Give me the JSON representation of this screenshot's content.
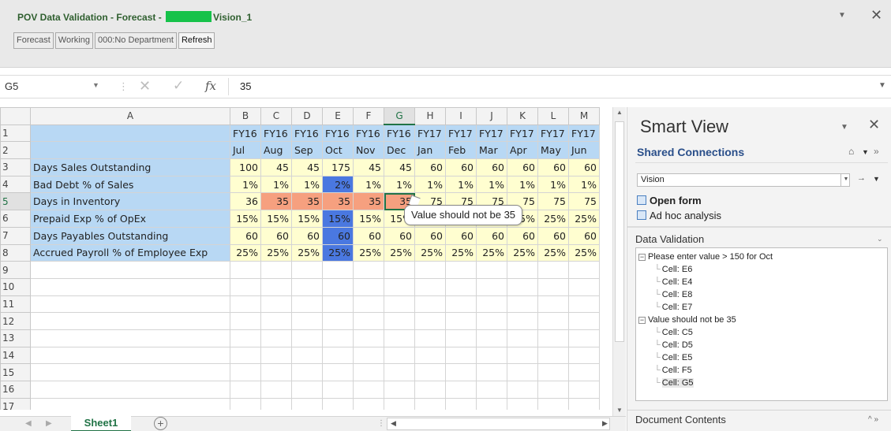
{
  "pov": {
    "title_prefix": "POV Data Validation - Forecast - ",
    "title_suffix": "Vision_1",
    "buttons": [
      "Forecast",
      "Working",
      "000:No Department",
      "Refresh"
    ]
  },
  "formula_bar": {
    "name_box": "G5",
    "fx": "fx",
    "value": "35"
  },
  "sheet": {
    "columns": [
      "A",
      "B",
      "C",
      "D",
      "E",
      "F",
      "G",
      "H",
      "I",
      "J",
      "K",
      "L",
      "M"
    ],
    "selected_column": "G",
    "selected_row": 5,
    "rows": [
      {
        "num": "1",
        "label": "",
        "cells": [
          "FY16",
          "FY16",
          "FY16",
          "FY16",
          "FY16",
          "FY16",
          "FY17",
          "FY17",
          "FY17",
          "FY17",
          "FY17",
          "FY17"
        ],
        "kind": "hdr"
      },
      {
        "num": "2",
        "label": "",
        "cells": [
          "Jul",
          "Aug",
          "Sep",
          "Oct",
          "Nov",
          "Dec",
          "Jan",
          "Feb",
          "Mar",
          "Apr",
          "May",
          "Jun"
        ],
        "kind": "hdr"
      },
      {
        "num": "3",
        "label": "Days Sales Outstanding",
        "cells": [
          "100",
          "45",
          "45",
          "175",
          "45",
          "45",
          "60",
          "60",
          "60",
          "60",
          "60",
          "60"
        ],
        "kind": "val"
      },
      {
        "num": "4",
        "label": "Bad Debt % of Sales",
        "cells": [
          "1%",
          "1%",
          "1%",
          "2%",
          "1%",
          "1%",
          "1%",
          "1%",
          "1%",
          "1%",
          "1%",
          "1%"
        ],
        "kind": "val"
      },
      {
        "num": "5",
        "label": "Days in Inventory",
        "cells": [
          "36",
          "35",
          "35",
          "35",
          "35",
          "35",
          "75",
          "75",
          "75",
          "75",
          "75",
          "75"
        ],
        "kind": "val"
      },
      {
        "num": "6",
        "label": "Prepaid Exp % of OpEx",
        "cells": [
          "15%",
          "15%",
          "15%",
          "15%",
          "15%",
          "15%",
          "25%",
          "25%",
          "25%",
          "25%",
          "25%",
          "25%"
        ],
        "kind": "val"
      },
      {
        "num": "7",
        "label": "Days Payables Outstanding",
        "cells": [
          "60",
          "60",
          "60",
          "60",
          "60",
          "60",
          "60",
          "60",
          "60",
          "60",
          "60",
          "60"
        ],
        "kind": "val"
      },
      {
        "num": "8",
        "label": "Accrued Payroll % of Employee Exp",
        "cells": [
          "25%",
          "25%",
          "25%",
          "25%",
          "25%",
          "25%",
          "25%",
          "25%",
          "25%",
          "25%",
          "25%",
          "25%"
        ],
        "kind": "val"
      },
      {
        "num": "9"
      },
      {
        "num": "10"
      },
      {
        "num": "11"
      },
      {
        "num": "12"
      },
      {
        "num": "13"
      },
      {
        "num": "14"
      },
      {
        "num": "15"
      },
      {
        "num": "16"
      },
      {
        "num": "17"
      }
    ],
    "highlights": {
      "blue": [
        "E4",
        "E6",
        "E7",
        "E8"
      ],
      "salmon": [
        "C5",
        "D5",
        "E5",
        "F5",
        "G5"
      ]
    },
    "colors": {
      "blue": "#4a78e0",
      "salmon": "#f6a07f",
      "label_bg": "#b8d8f4",
      "value_bg": "#fffed0"
    }
  },
  "tooltip": {
    "text": "Value should not be 35"
  },
  "tabs": {
    "sheet_name": "Sheet1",
    "add_icon": "+"
  },
  "smart_view": {
    "title": "Smart View",
    "shared_connections": "Shared Connections",
    "connection": "Vision",
    "open_form": "Open form",
    "ad_hoc": "Ad hoc analysis",
    "data_validation_title": "Data Validation",
    "tree": [
      {
        "text": "Please enter value > 150 for Oct",
        "children": [
          "Cell:  E6",
          "Cell:  E4",
          "Cell:  E8",
          "Cell:  E7"
        ]
      },
      {
        "text": "Value should not be 35",
        "children": [
          "Cell:  C5",
          "Cell:  D5",
          "Cell:  E5",
          "Cell:  F5",
          "Cell:  G5"
        ]
      }
    ],
    "document_contents": "Document Contents"
  }
}
